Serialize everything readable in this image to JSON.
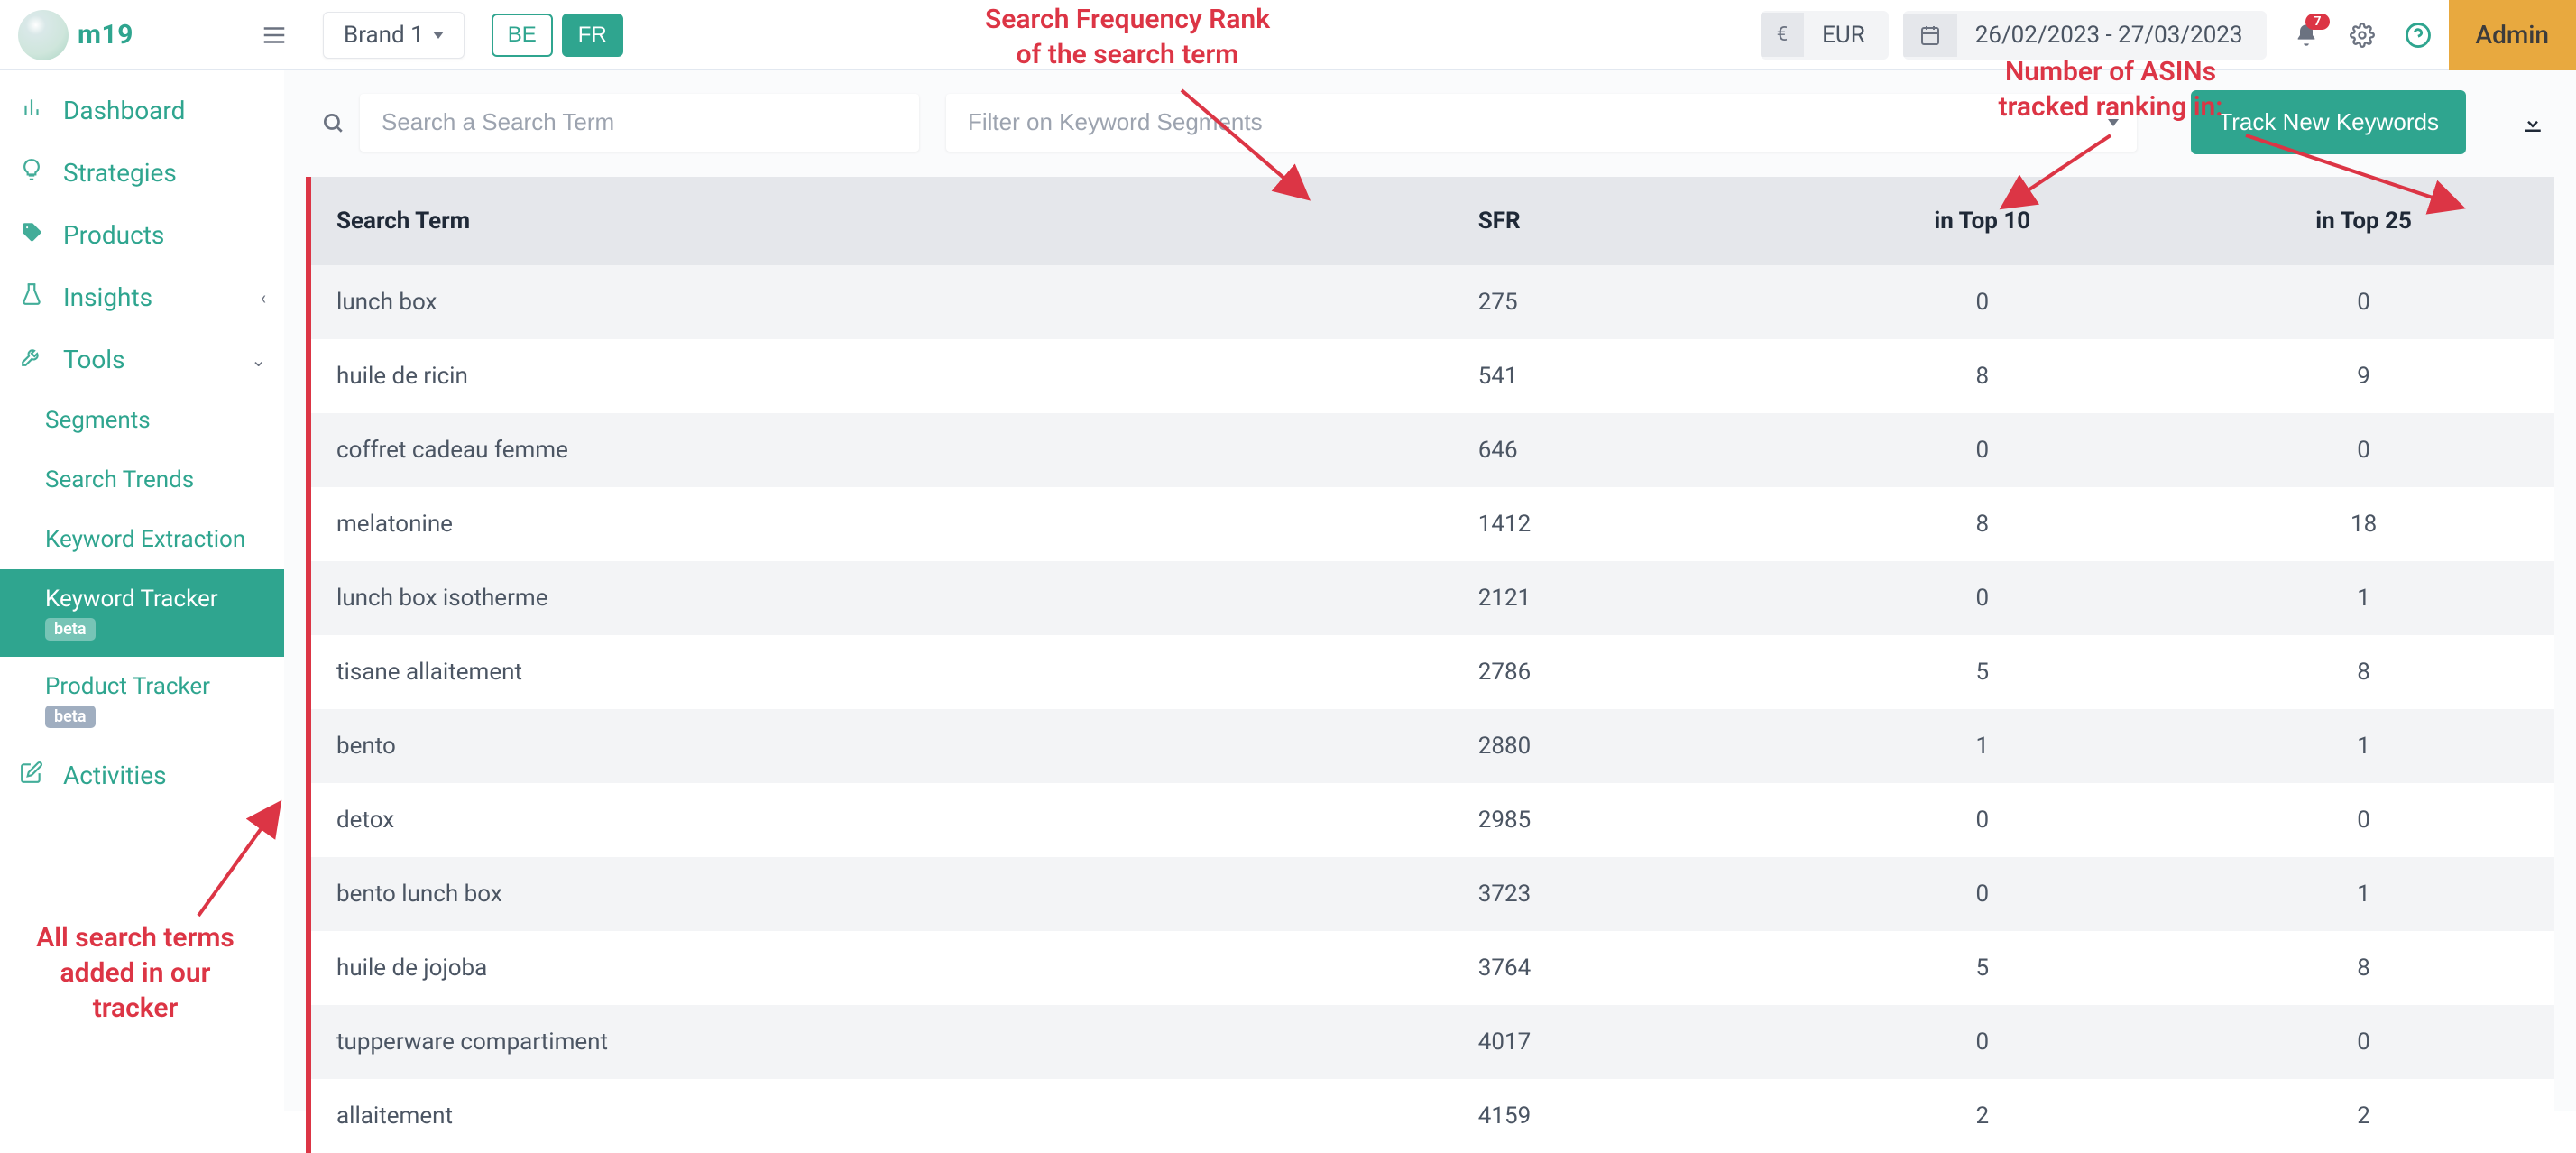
{
  "logo_text": "m19",
  "brand_selector": {
    "label": "Brand 1"
  },
  "marketplaces": [
    {
      "code": "BE",
      "active": false
    },
    {
      "code": "FR",
      "active": true
    }
  ],
  "currency": {
    "symbol": "€",
    "code": "EUR"
  },
  "date_range": "26/02/2023 - 27/03/2023",
  "notifications_count": "7",
  "admin_label": "Admin",
  "sidebar": {
    "items": [
      {
        "label": "Dashboard",
        "icon": "chart-bar"
      },
      {
        "label": "Strategies",
        "icon": "lightbulb"
      },
      {
        "label": "Products",
        "icon": "tags"
      },
      {
        "label": "Insights",
        "icon": "flask",
        "chev": "left"
      },
      {
        "label": "Tools",
        "icon": "tools",
        "chev": "down"
      }
    ],
    "sub_items": [
      {
        "label": "Segments"
      },
      {
        "label": "Search Trends"
      },
      {
        "label": "Keyword Extraction"
      },
      {
        "label": "Keyword Tracker",
        "beta": "beta",
        "active": true
      },
      {
        "label": "Product Tracker",
        "beta": "beta"
      }
    ],
    "activities": {
      "label": "Activities",
      "icon": "edit"
    }
  },
  "search": {
    "placeholder": "Search a Search Term"
  },
  "filter": {
    "placeholder": "Filter on Keyword Segments"
  },
  "track_button": "Track New Keywords",
  "columns": {
    "c1": "Search Term",
    "c2": "SFR",
    "c3": "in Top 10",
    "c4": "in Top 25"
  },
  "rows": [
    {
      "term": "lunch box",
      "sfr": "275",
      "top10": "0",
      "top25": "0"
    },
    {
      "term": "huile de ricin",
      "sfr": "541",
      "top10": "8",
      "top25": "9"
    },
    {
      "term": "coffret cadeau femme",
      "sfr": "646",
      "top10": "0",
      "top25": "0"
    },
    {
      "term": "melatonine",
      "sfr": "1412",
      "top10": "8",
      "top25": "18"
    },
    {
      "term": "lunch box isotherme",
      "sfr": "2121",
      "top10": "0",
      "top25": "1"
    },
    {
      "term": "tisane allaitement",
      "sfr": "2786",
      "top10": "5",
      "top25": "8"
    },
    {
      "term": "bento",
      "sfr": "2880",
      "top10": "1",
      "top25": "1"
    },
    {
      "term": "detox",
      "sfr": "2985",
      "top10": "0",
      "top25": "0"
    },
    {
      "term": "bento lunch box",
      "sfr": "3723",
      "top10": "0",
      "top25": "1"
    },
    {
      "term": "huile de jojoba",
      "sfr": "3764",
      "top10": "5",
      "top25": "8"
    },
    {
      "term": "tupperware compartiment",
      "sfr": "4017",
      "top10": "0",
      "top25": "0"
    },
    {
      "term": "allaitement",
      "sfr": "4159",
      "top10": "2",
      "top25": "2"
    }
  ],
  "annotations": {
    "sfr": "Search Frequency Rank\nof the search term",
    "asins": "Number of ASINs\ntracked ranking in:",
    "tracker": "All search terms\nadded in our\ntracker"
  }
}
